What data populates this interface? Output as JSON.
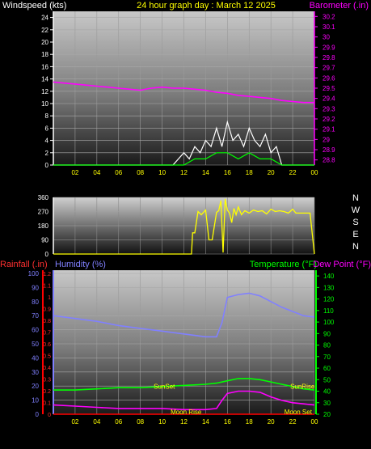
{
  "header": {
    "left": "Windspeed (kts)",
    "center": "24 hour graph day : March 12 2025",
    "right": "Barometer (.in)"
  },
  "colors": {
    "wind": "#ffffff",
    "gust": "#00ff00",
    "baro": "#ff00ff",
    "dir": "#ffff00",
    "rain": "#ff0000",
    "humidity": "#8080ff",
    "temp": "#00ff00",
    "dew": "#ff00ff",
    "header_center": "#ffff00",
    "header_left": "#ffffff",
    "header_right": "#ff00ff"
  },
  "chart_data": [
    {
      "type": "line",
      "id": "wind_baro",
      "x_ticks": [
        "02",
        "04",
        "06",
        "08",
        "10",
        "12",
        "14",
        "16",
        "18",
        "20",
        "22",
        "00"
      ],
      "left_ticks": [
        "0",
        "2",
        "4",
        "6",
        "8",
        "10",
        "12",
        "14",
        "16",
        "18",
        "20",
        "22",
        "24"
      ],
      "right_ticks": [
        "28.8",
        "28.9",
        "29",
        "29.1",
        "29.2",
        "29.3",
        "29.4",
        "29.5",
        "29.6",
        "29.7",
        "29.8",
        "29.9",
        "30",
        "30.1",
        "30.2"
      ],
      "ylim_wind": [
        0,
        25
      ],
      "ylim_baro": [
        28.75,
        30.25
      ],
      "series": [
        {
          "name": "Barometer (.in)",
          "axis": "right",
          "x": [
            0,
            1,
            2,
            3,
            4,
            5,
            6,
            7,
            8,
            9,
            10,
            11,
            12,
            13,
            14,
            15,
            16,
            17,
            18,
            19,
            20,
            21,
            22,
            23,
            24
          ],
          "values": [
            29.56,
            29.55,
            29.54,
            29.53,
            29.52,
            29.51,
            29.5,
            29.49,
            29.48,
            29.5,
            29.51,
            29.5,
            29.5,
            29.49,
            29.48,
            29.46,
            29.45,
            29.43,
            29.42,
            29.41,
            29.4,
            29.38,
            29.37,
            29.36,
            29.36
          ]
        },
        {
          "name": "Windspeed (kts)",
          "axis": "left",
          "x": [
            0,
            1,
            2,
            3,
            4,
            5,
            6,
            7,
            8,
            9,
            10,
            11,
            12,
            12.5,
            13,
            13.5,
            14,
            14.5,
            15,
            15.5,
            16,
            16.5,
            17,
            17.5,
            18,
            18.5,
            19,
            19.5,
            20,
            20.5,
            21,
            22,
            23,
            24
          ],
          "values": [
            0,
            0,
            0,
            0,
            0,
            0,
            0,
            0,
            0,
            0,
            0,
            0,
            2,
            1,
            3,
            2,
            4,
            3,
            6,
            3,
            7,
            4,
            5,
            3,
            6,
            4,
            3,
            5,
            2,
            3,
            0,
            0,
            0,
            0
          ]
        },
        {
          "name": "Gust",
          "axis": "left",
          "x": [
            0,
            12,
            13,
            14,
            15,
            16,
            17,
            18,
            19,
            20,
            21,
            24
          ],
          "values": [
            0,
            0,
            1,
            1,
            2,
            2,
            1,
            2,
            1,
            1,
            0,
            0
          ]
        }
      ]
    },
    {
      "type": "line",
      "id": "direction",
      "y_ticks": [
        "0",
        "90",
        "180",
        "270",
        "360"
      ],
      "right_labels": [
        "N",
        "W",
        "S",
        "E",
        "N"
      ],
      "ylim": [
        0,
        360
      ],
      "x": [
        0,
        11,
        12.7,
        12.8,
        13,
        13.3,
        13.6,
        14,
        14.3,
        14.6,
        15,
        15.2,
        15.4,
        15.6,
        15.8,
        16,
        16.2,
        16.4,
        16.6,
        16.8,
        17,
        17.3,
        17.6,
        18,
        18.4,
        18.8,
        19.2,
        19.6,
        20,
        20.4,
        20.8,
        21.2,
        21.6,
        22,
        22.3,
        23.6,
        24
      ],
      "values": [
        0,
        0,
        0,
        135,
        135,
        270,
        250,
        280,
        90,
        90,
        265,
        275,
        340,
        10,
        350,
        280,
        260,
        200,
        290,
        250,
        300,
        250,
        275,
        260,
        280,
        270,
        275,
        255,
        285,
        270,
        275,
        270,
        260,
        285,
        260,
        260,
        0
      ]
    },
    {
      "type": "line",
      "id": "temp_hum",
      "x_ticks": [
        "02",
        "04",
        "06",
        "08",
        "10",
        "12",
        "14",
        "16",
        "18",
        "20",
        "22",
        "00"
      ],
      "rain_ticks": [
        "0",
        "0.1",
        "0.2",
        "0.3",
        "0.4",
        "0.5",
        "0.6",
        "0.7",
        "0.8",
        "0.9",
        "1",
        "1.1",
        "1.2"
      ],
      "humidity_ticks": [
        "0",
        "10",
        "20",
        "30",
        "40",
        "50",
        "60",
        "70",
        "80",
        "90",
        "100"
      ],
      "temp_ticks": [
        "20",
        "30",
        "40",
        "50",
        "60",
        "70",
        "80",
        "90",
        "100",
        "110",
        "120",
        "130",
        "140"
      ],
      "labels": {
        "rain": "Rainfall (.in)",
        "humidity": "Humidity (%)",
        "temp": "Temperature (°F)",
        "dew": "Dew Point (°F)"
      },
      "events": [
        {
          "label": "SunSet",
          "x": 10.2,
          "y": 42
        },
        {
          "label": "SunRise",
          "x": 22.9,
          "y": 42
        },
        {
          "label": "Moon Rise",
          "x": 12.2,
          "y": 20
        },
        {
          "label": "Moon Set",
          "x": 22.5,
          "y": 20
        }
      ],
      "ylim_temp": [
        20,
        145
      ],
      "series": [
        {
          "name": "Humidity (%)",
          "axis": "humidity",
          "x": [
            0,
            2,
            4,
            6,
            8,
            10,
            12,
            14,
            15,
            15.5,
            16,
            17,
            18,
            19,
            20,
            21,
            22,
            23,
            24
          ],
          "values": [
            70,
            68,
            66,
            63,
            61,
            59,
            57,
            55,
            55,
            65,
            83,
            85,
            86,
            84,
            80,
            76,
            73,
            70,
            69
          ]
        },
        {
          "name": "Temperature (°F)",
          "axis": "temp",
          "x": [
            0,
            2,
            4,
            6,
            8,
            10,
            12,
            14,
            15,
            16,
            17,
            18,
            19,
            20,
            21,
            22,
            23,
            24
          ],
          "values": [
            41,
            41,
            42,
            43,
            43,
            44,
            45,
            46,
            47,
            49,
            51,
            51,
            50,
            48,
            46,
            44,
            42,
            41
          ]
        },
        {
          "name": "Dew Point (°F)",
          "axis": "temp",
          "x": [
            0,
            2,
            4,
            6,
            8,
            10,
            12,
            14,
            15,
            15.5,
            16,
            17,
            18,
            19,
            20,
            21,
            22,
            23,
            24
          ],
          "values": [
            28,
            27,
            26,
            25,
            25,
            25,
            24,
            24,
            25,
            32,
            38,
            40,
            40,
            39,
            35,
            32,
            30,
            29,
            28
          ]
        },
        {
          "name": "Rainfall (.in)",
          "axis": "rain",
          "x": [
            0,
            24
          ],
          "values": [
            0,
            0
          ]
        }
      ]
    }
  ]
}
